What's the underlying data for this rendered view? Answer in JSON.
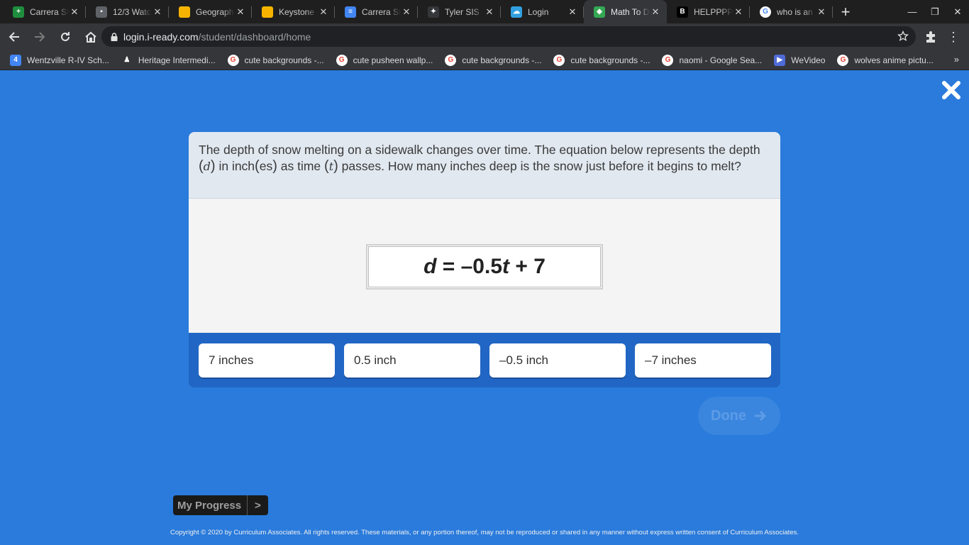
{
  "browser": {
    "tabs": [
      {
        "title": "Carrera St",
        "icon_color": "#1e8e3e",
        "glyph": "+"
      },
      {
        "title": "12/3 Watc",
        "icon_color": "#5f6368",
        "glyph": "▪"
      },
      {
        "title": "Geograph",
        "icon_color": "#f6b400",
        "glyph": ""
      },
      {
        "title": "Keystone",
        "icon_color": "#f6b400",
        "glyph": ""
      },
      {
        "title": "Carrera St",
        "icon_color": "#4285f4",
        "glyph": "≡"
      },
      {
        "title": "Tyler SIS",
        "icon_color": "#35363a",
        "glyph": "✦"
      },
      {
        "title": "Login",
        "icon_color": "#31a0e0",
        "glyph": "☁"
      },
      {
        "title": "Math To D",
        "icon_color": "#34a853",
        "glyph": "◆"
      },
      {
        "title": "HELPPPP",
        "icon_color": "#000000",
        "glyph": "B"
      },
      {
        "title": "who is an",
        "icon_color": "#ffffff",
        "glyph": "G"
      }
    ],
    "active_tab": 7,
    "url_host": "login.i-ready.com",
    "url_path": "/student/dashboard/home",
    "bookmarks": [
      {
        "label": "Wentzville R-IV Sch...",
        "icon_color": "#4285f4",
        "glyph": "4"
      },
      {
        "label": "Heritage Intermedi...",
        "icon_color": "#35363a",
        "glyph": "♟"
      },
      {
        "label": "cute backgrounds -...",
        "icon_color": "#ffffff",
        "glyph": "G"
      },
      {
        "label": "cute pusheen wallp...",
        "icon_color": "#ffffff",
        "glyph": "G"
      },
      {
        "label": "cute backgrounds -...",
        "icon_color": "#ffffff",
        "glyph": "G"
      },
      {
        "label": "cute backgrounds -...",
        "icon_color": "#ffffff",
        "glyph": "G"
      },
      {
        "label": "naomi - Google Sea...",
        "icon_color": "#ffffff",
        "glyph": "G"
      },
      {
        "label": "WeVideo",
        "icon_color": "#4f6bd8",
        "glyph": "▶"
      },
      {
        "label": "wolves anime pictu...",
        "icon_color": "#ffffff",
        "glyph": "G"
      }
    ],
    "bookmarks_more": "»"
  },
  "question": {
    "part1": "The depth of snow melting on a sidewalk changes over time. The equation below represents the depth ",
    "var_d": "d",
    "part2": " in inch",
    "part2b": "es",
    "part3": " as time ",
    "var_t": "t",
    "part4": " passes. How many inches deep is the snow just before it begins to melt?"
  },
  "equation": {
    "lhs": "d",
    "mid": " = –0.5",
    "var": "t",
    "rhs": " + 7"
  },
  "answers": [
    "7 inches",
    "0.5 inch",
    "–0.5 inch",
    "–7 inches"
  ],
  "done_label": "Done",
  "progress_label": "My Progress",
  "progress_arrow": ">",
  "copyright": "Copyright © 2020 by Curriculum Associates. All rights reserved. These materials, or any portion thereof, may not be reproduced or shared in any manner without express written consent of Curriculum Associates.",
  "colors": {
    "page_bg": "#2a7bdc",
    "answer_band": "#2166c4",
    "question_bg": "#e1e8f0"
  }
}
